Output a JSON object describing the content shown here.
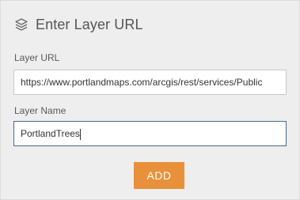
{
  "header": {
    "title": "Enter Layer URL",
    "icon": "layers-icon"
  },
  "fields": {
    "url_label": "Layer URL",
    "url_value": "https://www.portlandmaps.com/arcgis/rest/services/Public",
    "name_label": "Layer Name",
    "name_value": "PortlandTrees"
  },
  "actions": {
    "add_label": "ADD"
  },
  "colors": {
    "panel_background": "#eeeeee",
    "accent_button": "#e8913a",
    "focused_border": "#4a6a8a"
  }
}
